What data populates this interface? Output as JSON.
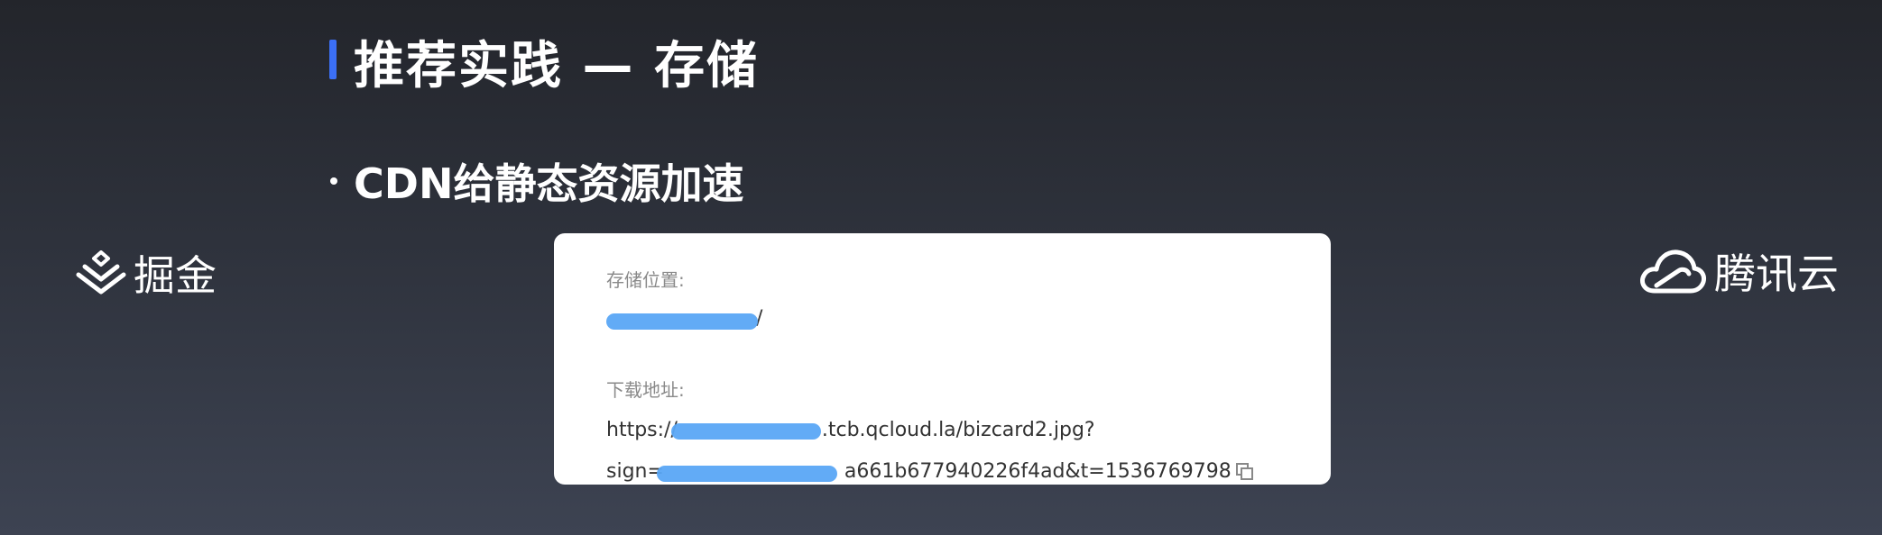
{
  "slide": {
    "title": "推荐实践 — 存储",
    "bullet": "CDN给静态资源加速"
  },
  "logos": {
    "left_text": "掘金",
    "right_text": "腾讯云",
    "left_icon": "juejin-logo-icon",
    "right_icon": "tencent-cloud-logo-icon"
  },
  "card": {
    "storage_label": "存储位置:",
    "storage_value": "/",
    "download_label": "下载地址:",
    "url_line1_suffix": ".tcb.qcloud.la/bizcard2.jpg?",
    "url_line1_prefix": "https://",
    "url_line2_prefix": "sign=",
    "url_line2_suffix": "a661b677940226f4ad&t=1536769798"
  },
  "colors": {
    "accent": "#3b6ff5",
    "redaction": "#5aa6f5"
  }
}
